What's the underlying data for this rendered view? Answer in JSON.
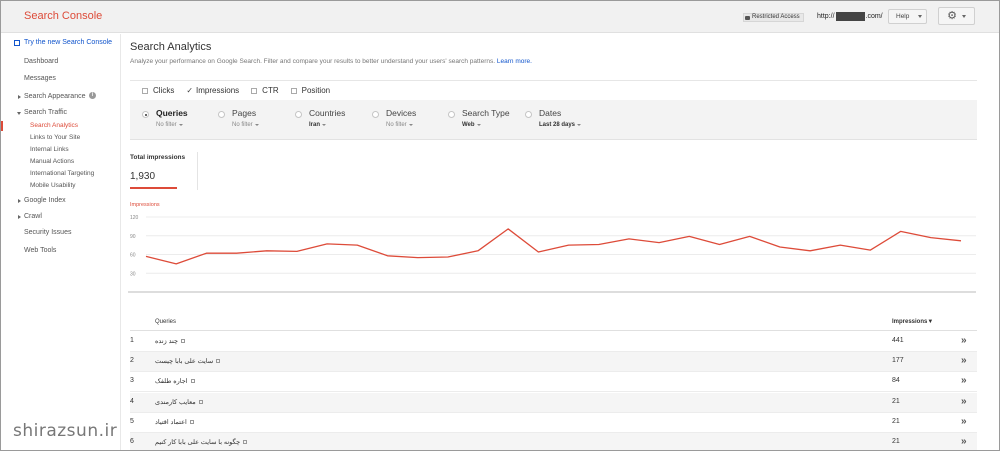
{
  "brand": "Search Console",
  "topbar": {
    "restricted": "Restricted Access",
    "url_prefix": "http://",
    "url_suffix": ".com/",
    "help": "Help",
    "gear": "⚙"
  },
  "sidebar": {
    "new_link": "Try the new Search Console",
    "dashboard": "Dashboard",
    "messages": "Messages",
    "search_appearance": "Search Appearance",
    "search_traffic": "Search Traffic",
    "sub": {
      "analytics": "Search Analytics",
      "links": "Links to Your Site",
      "internal": "Internal Links",
      "manual": "Manual Actions",
      "intl": "International Targeting",
      "mobile": "Mobile Usability"
    },
    "google_index": "Google Index",
    "crawl": "Crawl",
    "security": "Security Issues",
    "web_tools": "Web Tools",
    "info": "i"
  },
  "main": {
    "title": "Search Analytics",
    "subtitle": "Analyze your performance on Google Search. Filter and compare your results to better understand your users' search patterns.",
    "learn_more": "Learn more."
  },
  "metrics": {
    "clicks": "Clicks",
    "impressions": "Impressions",
    "impressions_check": "✓",
    "ctr": "CTR",
    "position": "Position"
  },
  "filters": {
    "queries": {
      "label": "Queries",
      "value": "No filter"
    },
    "pages": {
      "label": "Pages",
      "value": "No filter"
    },
    "countries": {
      "label": "Countries",
      "value": "Iran"
    },
    "devices": {
      "label": "Devices",
      "value": "No filter"
    },
    "search_type": {
      "label": "Search Type",
      "value": "Web"
    },
    "dates": {
      "label": "Dates",
      "value": "Last 28 days"
    }
  },
  "total": {
    "label": "Total impressions",
    "value": "1,930"
  },
  "chart_data": {
    "type": "line",
    "title": "Impressions",
    "yticks": [
      "120",
      "90",
      "60",
      "30"
    ],
    "ylim": [
      0,
      120
    ],
    "grid": true,
    "color": "#dd4b39",
    "values": [
      57,
      45,
      62,
      62,
      66,
      65,
      77,
      75,
      58,
      55,
      56,
      66,
      101,
      64,
      75,
      76,
      85,
      79,
      89,
      76,
      89,
      72,
      66,
      75,
      67,
      97,
      87,
      82
    ]
  },
  "table": {
    "col_queries": "Queries",
    "col_impressions": "Impressions▼",
    "arrow": "»",
    "rows": [
      {
        "n": "1",
        "q": "چند زنده",
        "imp": "441"
      },
      {
        "n": "2",
        "q": "سایت علی بابا چیست",
        "imp": "177"
      },
      {
        "n": "3",
        "q": "اجاره طلفک",
        "imp": "84"
      },
      {
        "n": "4",
        "q": "معایب کارمندی",
        "imp": "21"
      },
      {
        "n": "5",
        "q": "اعتماد اقتیاد",
        "imp": "21"
      },
      {
        "n": "6",
        "q": "چگونه با سایت علی بابا کار کنیم",
        "imp": "21"
      }
    ]
  },
  "watermark": "shirazsun.ir"
}
